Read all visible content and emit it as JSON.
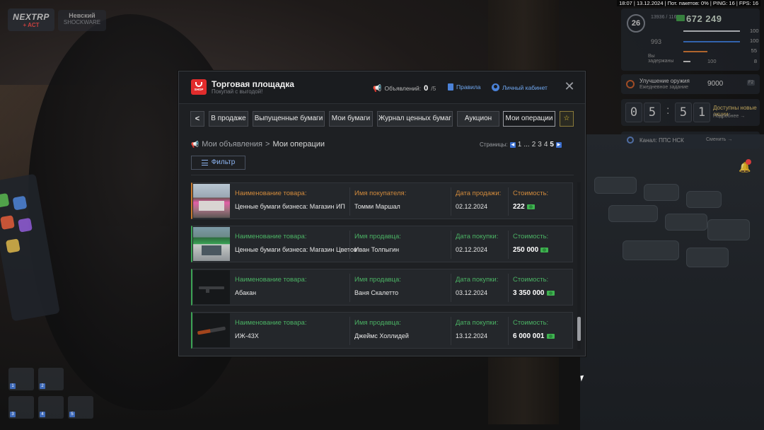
{
  "status_bar": "18:07 | 13.12.2024 | Пот. пакетов: 0% | PING: 16 | FPS: 16",
  "server": {
    "logo_line1": "NEXTRP",
    "logo_line2": "+ ACT",
    "name": "Невский",
    "subname": "SHOCKWARE"
  },
  "hud": {
    "level": "26",
    "xp": "13936 / 116000",
    "money": "672 249",
    "ammo": "993",
    "wanted": "Вы задержаны",
    "stats": [
      "100",
      "100",
      "55",
      "8"
    ],
    "stat_bottom": "100"
  },
  "quest": {
    "title": "Улучшение оружия",
    "subtitle": "Ежедневное задание",
    "value": "9000",
    "key": "F2"
  },
  "timer": {
    "d1": "0",
    "d2": "5",
    "d3": "5",
    "d4": "1",
    "title": "Доступны новые акции",
    "subtitle": "Подробнее →"
  },
  "channel": {
    "text": "Канал: ППС НСК",
    "change": "Сменить →"
  },
  "window": {
    "title": "Торговая площадка",
    "subtitle": "Покупай с выгодой!",
    "shop_label": "SHOP",
    "ads_label": "Объявлений:",
    "ads_count": "0",
    "ads_max": "/5",
    "rules": "Правила",
    "cabinet": "Личный кабинет",
    "close": "✕"
  },
  "tabs": [
    {
      "label": "<"
    },
    {
      "label": "В продаже"
    },
    {
      "label": "Выпущенные бумаги"
    },
    {
      "label": "Мои бумаги"
    },
    {
      "label": "Журнал ценных бумаг"
    },
    {
      "label": "Аукцион"
    },
    {
      "label": "Мои операции"
    },
    {
      "label": "☆"
    }
  ],
  "breadcrumb": {
    "parent": "Мои объявления",
    "sep": ">",
    "current": "Мои операции"
  },
  "pagination": {
    "label": "Страницы:",
    "pages": [
      "1",
      "...",
      "2",
      "3",
      "4",
      "5"
    ],
    "current": "5"
  },
  "filter": {
    "label": "Фильтр"
  },
  "rows": [
    {
      "type": "sold",
      "item_label": "Наименование товара:",
      "item": "Ценные бумаги бизнеса: Магазин ИП",
      "party_label": "Имя покупателя:",
      "party": "Томми Маршал",
      "date_label": "Дата продажи:",
      "date": "02.12.2024",
      "price_label": "Стоимость:",
      "price": "222"
    },
    {
      "type": "bought",
      "item_label": "Наименование товара:",
      "item": "Ценные бумаги бизнеса: Магазин Цветов",
      "party_label": "Имя продавца:",
      "party": "Иван Толпыгин",
      "date_label": "Дата покупки:",
      "date": "02.12.2024",
      "price_label": "Стоимость:",
      "price": "250 000"
    },
    {
      "type": "bought",
      "item_label": "Наименование товара:",
      "item": "Абакан",
      "party_label": "Имя продавца:",
      "party": "Ваня Скалетто",
      "date_label": "Дата покупки:",
      "date": "03.12.2024",
      "price_label": "Стоимость:",
      "price": "3 350 000"
    },
    {
      "type": "bought",
      "item_label": "Наименование товара:",
      "item": "ИЖ-43Х",
      "party_label": "Имя продавца:",
      "party": "Джеймс Холлидей",
      "date_label": "Дата покупки:",
      "date": "13.12.2024",
      "price_label": "Стоимость:",
      "price": "6 000 001"
    }
  ],
  "colors": {
    "sold": "#d18a3c",
    "bought": "#4bb264",
    "accent": "#6fa7f0",
    "brand": "#e12c2c"
  }
}
